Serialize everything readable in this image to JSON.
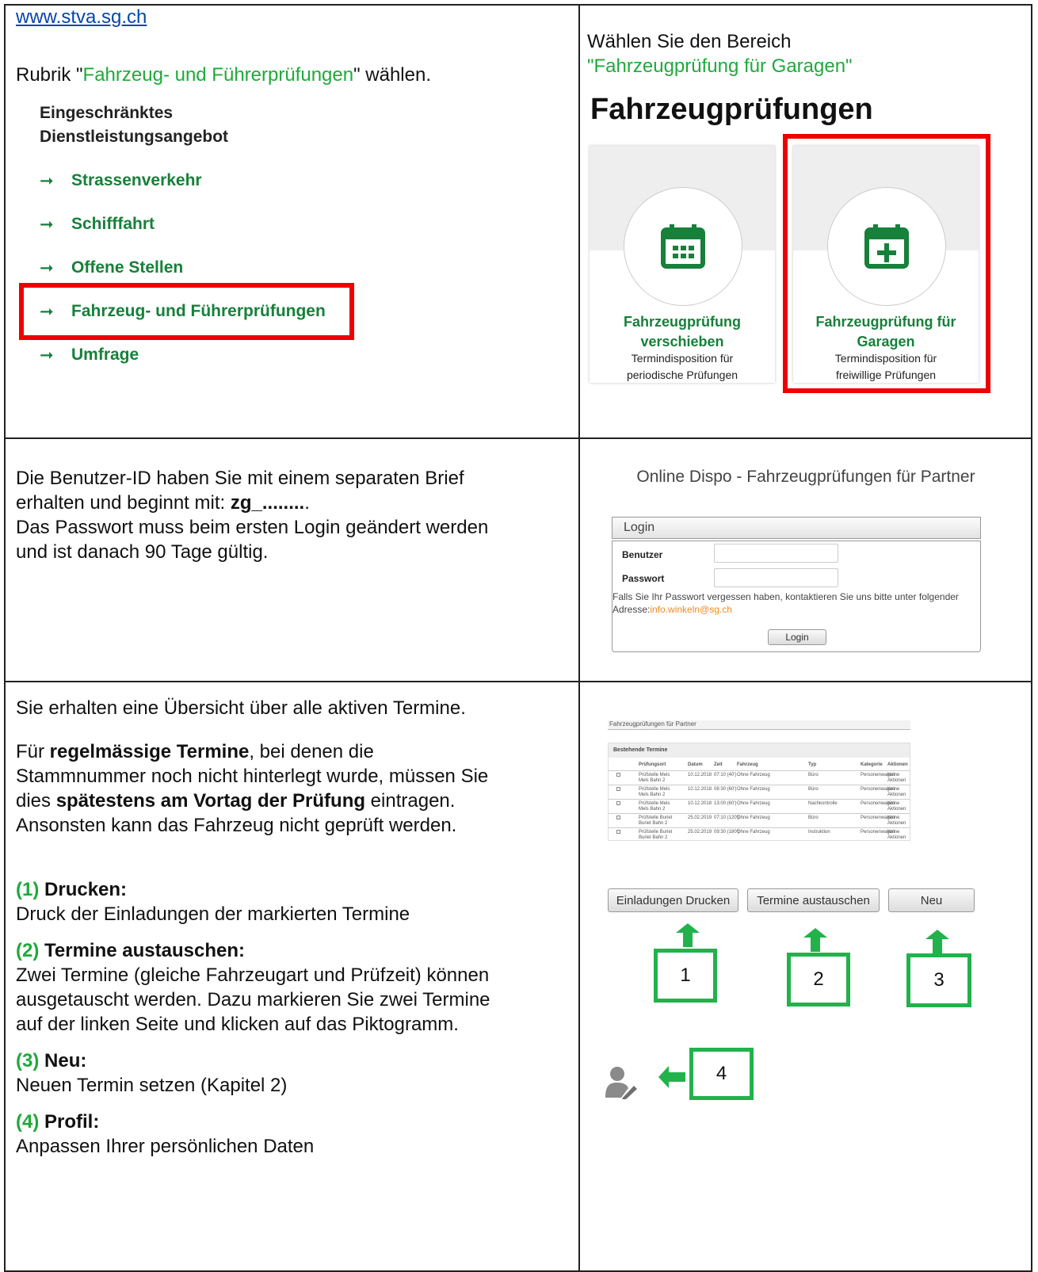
{
  "cell1": {
    "link": "www.stva.sg.ch",
    "instr_pre": "Rubrik \"",
    "instr_green": "Fahrzeug- und Führerprüfungen",
    "instr_post": "\" wählen.",
    "menu_title_1": "Eingeschränktes",
    "menu_title_2": "Dienstleistungsangebot",
    "menu_items": [
      "Strassenverkehr",
      "Schifffahrt",
      "Offene Stellen",
      "Fahrzeug- und Führerprüfungen",
      "Umfrage"
    ],
    "arrow": "➞"
  },
  "cell2": {
    "instr_1": "Wählen Sie den Bereich",
    "instr_2": "\"Fahrzeugprüfung für Garagen\"",
    "heading": "Fahrzeugprüfungen",
    "card1_title_1": "Fahrzeugprüfung",
    "card1_title_2": "verschieben",
    "card1_sub_1": "Termindisposition für",
    "card1_sub_2": "periodische Prüfungen",
    "card2_title_1": "Fahrzeugprüfung für",
    "card2_title_2": "Garagen",
    "card2_sub_1": "Termindisposition für",
    "card2_sub_2": "freiwillige Prüfungen"
  },
  "cell3": {
    "line1": "Die Benutzer-ID haben Sie mit einem separaten Brief",
    "line2_pre": "erhalten und beginnt mit: ",
    "line2_bold": "zg_........",
    "line2_post": ".",
    "line3": "Das Passwort muss beim ersten Login geändert werden",
    "line4": "und ist danach 90 Tage gültig."
  },
  "cell4": {
    "title": "Online Dispo - Fahrzeugprüfungen für Partner",
    "panel_header": "Login",
    "user_label": "Benutzer",
    "pass_label": "Passwort",
    "note_1": "Falls Sie Ihr Passwort vergessen haben, kontaktieren Sie uns bitte unter folgender",
    "note_2_pre": "Adresse:",
    "note_2_link": "info.winkeln@sg.ch",
    "login_button": "Login"
  },
  "cell5": {
    "intro": "Sie erhalten eine Übersicht über alle aktiven Termine.",
    "p_pre": "Für ",
    "p_bold1": "regelmässige Termine",
    "p_mid1": ", bei denen die",
    "p_line2": "Stammnummer noch nicht hinterlegt wurde, müssen Sie",
    "p_line3_pre": "dies ",
    "p_bold2": "spätestens am Vortag der Prüfung",
    "p_line3_post": " eintragen.",
    "p_line4": "Ansonsten kann das Fahrzeug nicht geprüft werden.",
    "items": [
      {
        "num": "(1)",
        "title": "Drucken:",
        "desc": "Druck der Einladungen der markierten Termine"
      },
      {
        "num": "(2)",
        "title": "Termine austauschen:",
        "desc1": "Zwei Termine (gleiche Fahrzeugart und Prüfzeit) können",
        "desc2": "ausgetauscht werden. Dazu markieren Sie zwei Termine",
        "desc3": "auf der linken Seite und klicken auf das Piktogramm."
      },
      {
        "num": "(3)",
        "title": "Neu:",
        "desc": "Neuen Termin setzen (Kapitel 2)"
      },
      {
        "num": "(4)",
        "title": "Profil:",
        "desc": "Anpassen Ihrer persönlichen Daten"
      }
    ]
  },
  "cell6": {
    "mini_title": "Fahrzeugprüfungen für Partner",
    "mini_section": "Bestehende Termine",
    "mini_headers": [
      "Prüfungsort",
      "Datum",
      "Zeit",
      "Fahrzeug",
      "Typ",
      "Kategorie",
      "Aktionen"
    ],
    "mini_rows": [
      [
        "Prüfstelle Mels",
        "Mels Bahn 2",
        "10.12.2018",
        "07:10 (40')",
        "Ohne Fahrzeug",
        "Büro",
        "Personenwagen",
        "Keine",
        "Aktionen"
      ],
      [
        "Prüfstelle Mels",
        "Mels Bahn 2",
        "10.12.2018",
        "08:30 (60')",
        "Ohne Fahrzeug",
        "Büro",
        "Personenwagen",
        "Keine",
        "Aktionen"
      ],
      [
        "Prüfstelle Mels",
        "Mels Bahn 2",
        "10.12.2018",
        "13:00 (60')",
        "Ohne Fahrzeug",
        "Nachkontrolle",
        "Personenwagen",
        "Keine",
        "Aktionen"
      ],
      [
        "Prüfstelle Buriet",
        "Buriet Bahn 2",
        "25.02.2019",
        "07:10 (120')",
        "Ohne Fahrzeug",
        "Büro",
        "Personenwagen",
        "Keine",
        "Aktionen"
      ],
      [
        "Prüfstelle Buriet",
        "Buriet Bahn 2",
        "25.02.2019",
        "09:30 (180')",
        "Ohne Fahrzeug",
        "Instruktion",
        "Personenwagen",
        "Keine",
        "Aktionen"
      ]
    ],
    "buttons": [
      "Einladungen Drucken",
      "Termine austauschen",
      "Neu"
    ],
    "numbers": [
      "1",
      "2",
      "3",
      "4"
    ]
  },
  "colors": {
    "green": "#1faa3a",
    "dark_green": "#17803a",
    "red": "#ee0000",
    "link": "#0645ad"
  }
}
